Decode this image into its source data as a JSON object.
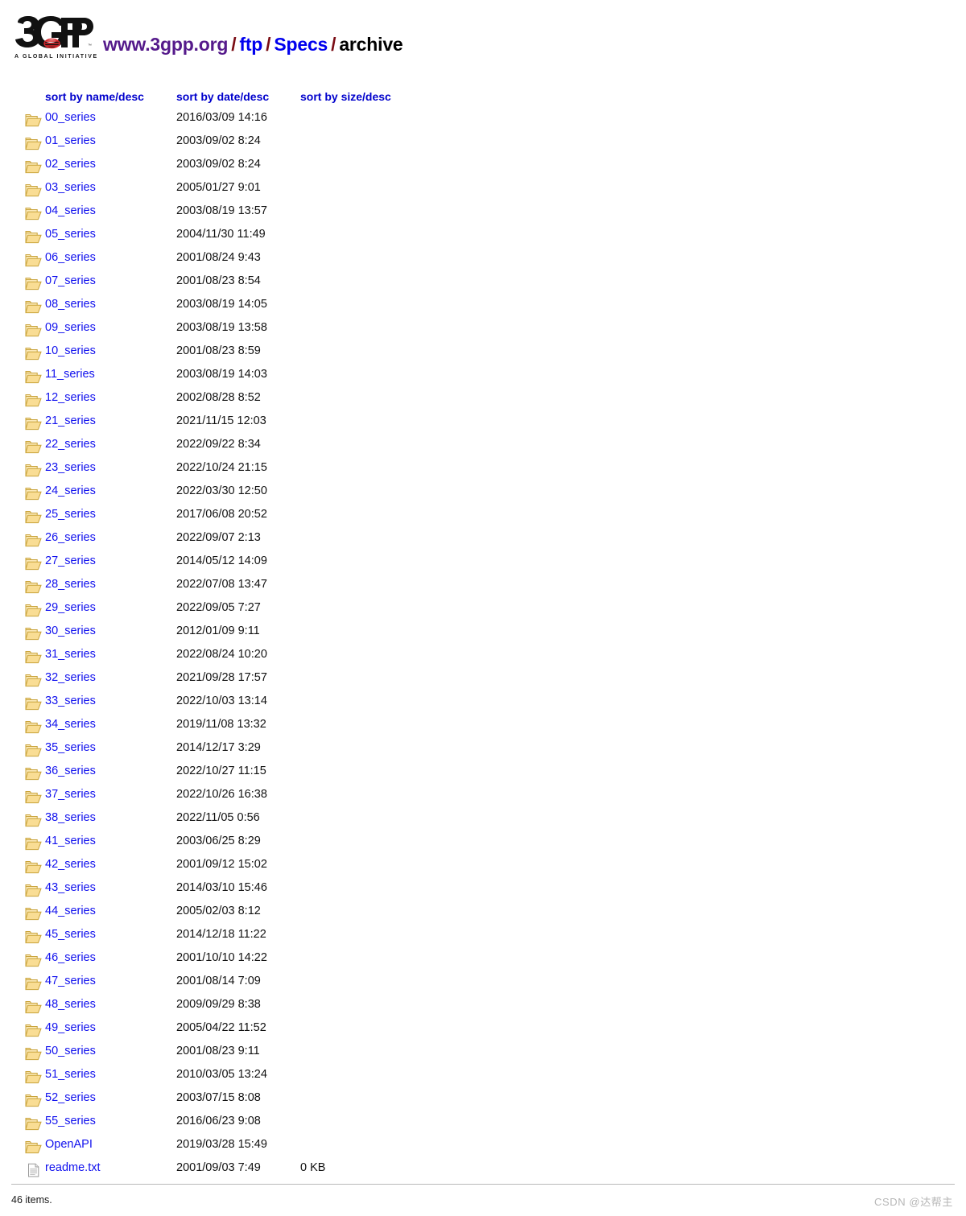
{
  "header": {
    "logo": {
      "text": "3GPP",
      "tagline": "A GLOBAL INITIATIVE"
    },
    "breadcrumb": {
      "host": "www.3gpp.org",
      "sep": "/",
      "parts": [
        "ftp",
        "Specs"
      ],
      "current": "archive"
    }
  },
  "colors": {
    "link": "#0000EE",
    "visited": "#551A8B",
    "separator": "#7a0c14",
    "header_link": "#0000CC",
    "folder_fill": "#f7de9b",
    "folder_border": "#c9a33a",
    "watermark": "#b6b6b6"
  },
  "columns": {
    "name": "sort by name/desc",
    "date": "sort by date/desc",
    "size": "sort by size/desc"
  },
  "rows": [
    {
      "icon": "folder-icon",
      "name": "00_series",
      "date": "2016/03/09 14:16",
      "size": ""
    },
    {
      "icon": "folder-icon",
      "name": "01_series",
      "date": "2003/09/02 8:24",
      "size": ""
    },
    {
      "icon": "folder-icon",
      "name": "02_series",
      "date": "2003/09/02 8:24",
      "size": ""
    },
    {
      "icon": "folder-icon",
      "name": "03_series",
      "date": "2005/01/27 9:01",
      "size": ""
    },
    {
      "icon": "folder-icon",
      "name": "04_series",
      "date": "2003/08/19 13:57",
      "size": ""
    },
    {
      "icon": "folder-icon",
      "name": "05_series",
      "date": "2004/11/30 11:49",
      "size": ""
    },
    {
      "icon": "folder-icon",
      "name": "06_series",
      "date": "2001/08/24 9:43",
      "size": ""
    },
    {
      "icon": "folder-icon",
      "name": "07_series",
      "date": "2001/08/23 8:54",
      "size": ""
    },
    {
      "icon": "folder-icon",
      "name": "08_series",
      "date": "2003/08/19 14:05",
      "size": ""
    },
    {
      "icon": "folder-icon",
      "name": "09_series",
      "date": "2003/08/19 13:58",
      "size": ""
    },
    {
      "icon": "folder-icon",
      "name": "10_series",
      "date": "2001/08/23 8:59",
      "size": ""
    },
    {
      "icon": "folder-icon",
      "name": "11_series",
      "date": "2003/08/19 14:03",
      "size": ""
    },
    {
      "icon": "folder-icon",
      "name": "12_series",
      "date": "2002/08/28 8:52",
      "size": ""
    },
    {
      "icon": "folder-icon",
      "name": "21_series",
      "date": "2021/11/15 12:03",
      "size": ""
    },
    {
      "icon": "folder-icon",
      "name": "22_series",
      "date": "2022/09/22 8:34",
      "size": ""
    },
    {
      "icon": "folder-icon",
      "name": "23_series",
      "date": "2022/10/24 21:15",
      "size": ""
    },
    {
      "icon": "folder-icon",
      "name": "24_series",
      "date": "2022/03/30 12:50",
      "size": ""
    },
    {
      "icon": "folder-icon",
      "name": "25_series",
      "date": "2017/06/08 20:52",
      "size": ""
    },
    {
      "icon": "folder-icon",
      "name": "26_series",
      "date": "2022/09/07 2:13",
      "size": ""
    },
    {
      "icon": "folder-icon",
      "name": "27_series",
      "date": "2014/05/12 14:09",
      "size": ""
    },
    {
      "icon": "folder-icon",
      "name": "28_series",
      "date": "2022/07/08 13:47",
      "size": ""
    },
    {
      "icon": "folder-icon",
      "name": "29_series",
      "date": "2022/09/05 7:27",
      "size": ""
    },
    {
      "icon": "folder-icon",
      "name": "30_series",
      "date": "2012/01/09 9:11",
      "size": ""
    },
    {
      "icon": "folder-icon",
      "name": "31_series",
      "date": "2022/08/24 10:20",
      "size": ""
    },
    {
      "icon": "folder-icon",
      "name": "32_series",
      "date": "2021/09/28 17:57",
      "size": ""
    },
    {
      "icon": "folder-icon",
      "name": "33_series",
      "date": "2022/10/03 13:14",
      "size": ""
    },
    {
      "icon": "folder-icon",
      "name": "34_series",
      "date": "2019/11/08 13:32",
      "size": ""
    },
    {
      "icon": "folder-icon",
      "name": "35_series",
      "date": "2014/12/17 3:29",
      "size": ""
    },
    {
      "icon": "folder-icon",
      "name": "36_series",
      "date": "2022/10/27 11:15",
      "size": ""
    },
    {
      "icon": "folder-icon",
      "name": "37_series",
      "date": "2022/10/26 16:38",
      "size": ""
    },
    {
      "icon": "folder-icon",
      "name": "38_series",
      "date": "2022/11/05 0:56",
      "size": ""
    },
    {
      "icon": "folder-icon",
      "name": "41_series",
      "date": "2003/06/25 8:29",
      "size": ""
    },
    {
      "icon": "folder-icon",
      "name": "42_series",
      "date": "2001/09/12 15:02",
      "size": ""
    },
    {
      "icon": "folder-icon",
      "name": "43_series",
      "date": "2014/03/10 15:46",
      "size": ""
    },
    {
      "icon": "folder-icon",
      "name": "44_series",
      "date": "2005/02/03 8:12",
      "size": ""
    },
    {
      "icon": "folder-icon",
      "name": "45_series",
      "date": "2014/12/18 11:22",
      "size": ""
    },
    {
      "icon": "folder-icon",
      "name": "46_series",
      "date": "2001/10/10 14:22",
      "size": ""
    },
    {
      "icon": "folder-icon",
      "name": "47_series",
      "date": "2001/08/14 7:09",
      "size": ""
    },
    {
      "icon": "folder-icon",
      "name": "48_series",
      "date": "2009/09/29 8:38",
      "size": ""
    },
    {
      "icon": "folder-icon",
      "name": "49_series",
      "date": "2005/04/22 11:52",
      "size": ""
    },
    {
      "icon": "folder-icon",
      "name": "50_series",
      "date": "2001/08/23 9:11",
      "size": ""
    },
    {
      "icon": "folder-icon",
      "name": "51_series",
      "date": "2010/03/05 13:24",
      "size": ""
    },
    {
      "icon": "folder-icon",
      "name": "52_series",
      "date": "2003/07/15 8:08",
      "size": ""
    },
    {
      "icon": "folder-icon",
      "name": "55_series",
      "date": "2016/06/23 9:08",
      "size": ""
    },
    {
      "icon": "folder-icon",
      "name": "OpenAPI",
      "date": "2019/03/28 15:49",
      "size": ""
    },
    {
      "icon": "file-icon",
      "name": "readme.txt",
      "date": "2001/09/03 7:49",
      "size": "0 KB"
    }
  ],
  "footer": {
    "item_count": "46 items.",
    "watermark": "CSDN @达帮主"
  }
}
